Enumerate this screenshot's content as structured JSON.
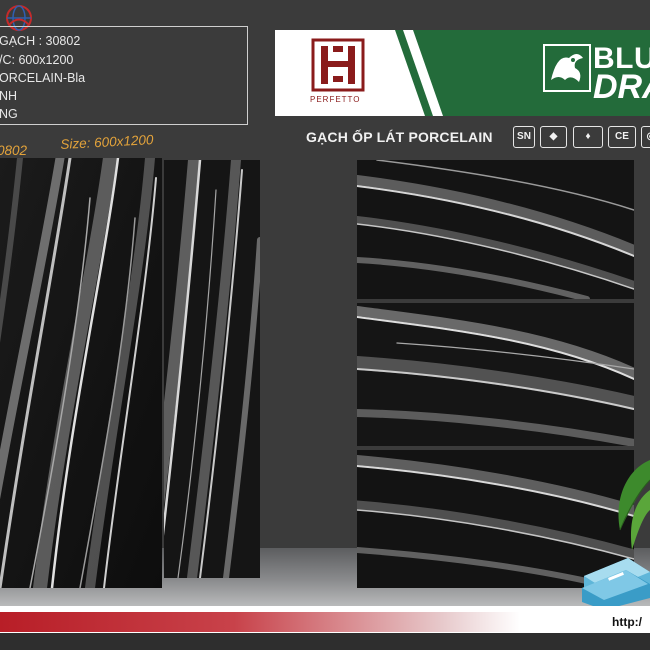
{
  "info": {
    "code_line": "GẠCH : 30802",
    "size_line": "/C: 600x1200",
    "type_line": "ORCELAIN-Bla",
    "line4": "NH",
    "line5": "NG"
  },
  "labels": {
    "code": "0802",
    "size": "Size: 600x1200",
    "product": "GẠCH ỐP LÁT PORCELAIN"
  },
  "brand": {
    "perfetto": "PERFETTO",
    "line1": "BLUE",
    "line2": "DRA"
  },
  "certs": [
    "SN",
    "◆",
    "♦",
    "CE",
    "◎"
  ],
  "footer": {
    "url": "http:/"
  },
  "colors": {
    "background": "#3b3b3b",
    "banner_green": "#236b3a",
    "accent_orange": "#e3a33b",
    "footer_red": "#b81e27",
    "perfetto_red": "#8a1b1b"
  },
  "icons": [
    "globe-logo-icon",
    "perfetto-logo-icon",
    "dragon-logo-icon",
    "sn-cert-icon",
    "diamond-cert-icon",
    "gem-cert-icon",
    "ce-cert-icon",
    "round-cert-icon",
    "plant-icon",
    "book-stack-icon"
  ]
}
